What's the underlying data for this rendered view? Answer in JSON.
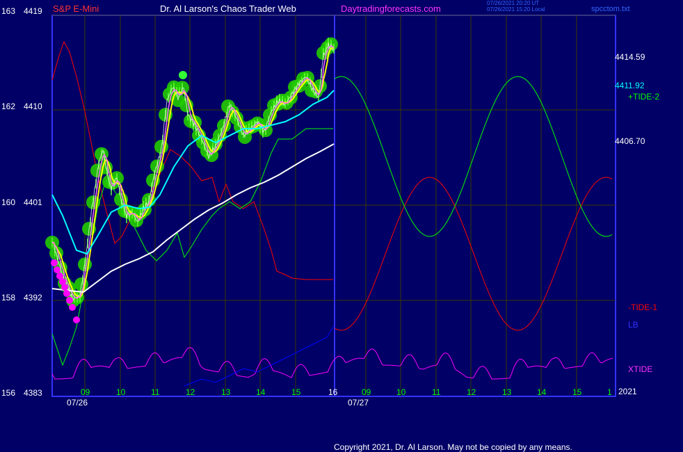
{
  "header": {
    "instrument": "S&P E-Mini",
    "author": "Dr. Al Larson's Chaos Trader Web",
    "site": "Daytradingforecasts.com",
    "timestamp_utc": "07/26/2021 20:20 UT",
    "timestamp_local": "07/26/2021 15:20 Local",
    "file": "spcctom.txt"
  },
  "footer": {
    "copyright": "Copyright 2021, Dr. Al Larson. May not be copied by any means.",
    "year": "2021"
  },
  "left_axis": {
    "labels": [
      {
        "left": "163",
        "right": "4419"
      },
      {
        "left": "162",
        "right": "4410"
      },
      {
        "left": "160",
        "right": "4401"
      },
      {
        "left": "158",
        "right": "4392"
      },
      {
        "left": "156",
        "right": "4383"
      }
    ]
  },
  "right_labels": {
    "price1": "4414.59",
    "price2": "4411.92",
    "price3": "4406.70",
    "tide2": "+TIDE-2",
    "tide1": "-TIDE-1",
    "lb": "LB",
    "xtide": "XTIDE"
  },
  "x_axis": {
    "hours": [
      "09",
      "10",
      "11",
      "12",
      "13",
      "14",
      "15",
      "16",
      "09",
      "10",
      "11",
      "12",
      "13",
      "14",
      "15",
      "1"
    ],
    "dates": [
      "07/26",
      "07/27"
    ]
  },
  "colors": {
    "background": "#000066",
    "frame": "#3333ff",
    "grid": "#3a3a00",
    "price_halo": "#22cc00",
    "price_line": "#ffffff",
    "ma_fast": "#ffff00",
    "ma_mid": "#00ffff",
    "ma_slow": "#ffffff",
    "tide1": "#ff0000",
    "tide2": "#00ff00",
    "xtide": "#ff00ff",
    "lb": "#0000ff",
    "magenta_dots": "#ff00ff",
    "title_red": "#ff3333",
    "title_white": "#ffffff",
    "title_magenta": "#ff33ff"
  },
  "chart_data": {
    "type": "line",
    "title": "S&P E-Mini",
    "ylabel": "",
    "xlabel": "",
    "ylim": [
      4383,
      4419
    ],
    "x_ticks_hours_day1": [
      "09",
      "10",
      "11",
      "12",
      "13",
      "14",
      "15",
      "16"
    ],
    "x_ticks_hours_day2": [
      "09",
      "10",
      "11",
      "12",
      "13",
      "14",
      "15",
      "1"
    ],
    "price_levels_marked": [
      4414.59,
      4411.92,
      4406.7
    ],
    "series": [
      {
        "name": "+TIDE-2",
        "kind": "forecast"
      },
      {
        "name": "-TIDE-1",
        "kind": "forecast"
      },
      {
        "name": "LB",
        "kind": "forecast"
      },
      {
        "name": "XTIDE",
        "kind": "forecast"
      }
    ]
  }
}
